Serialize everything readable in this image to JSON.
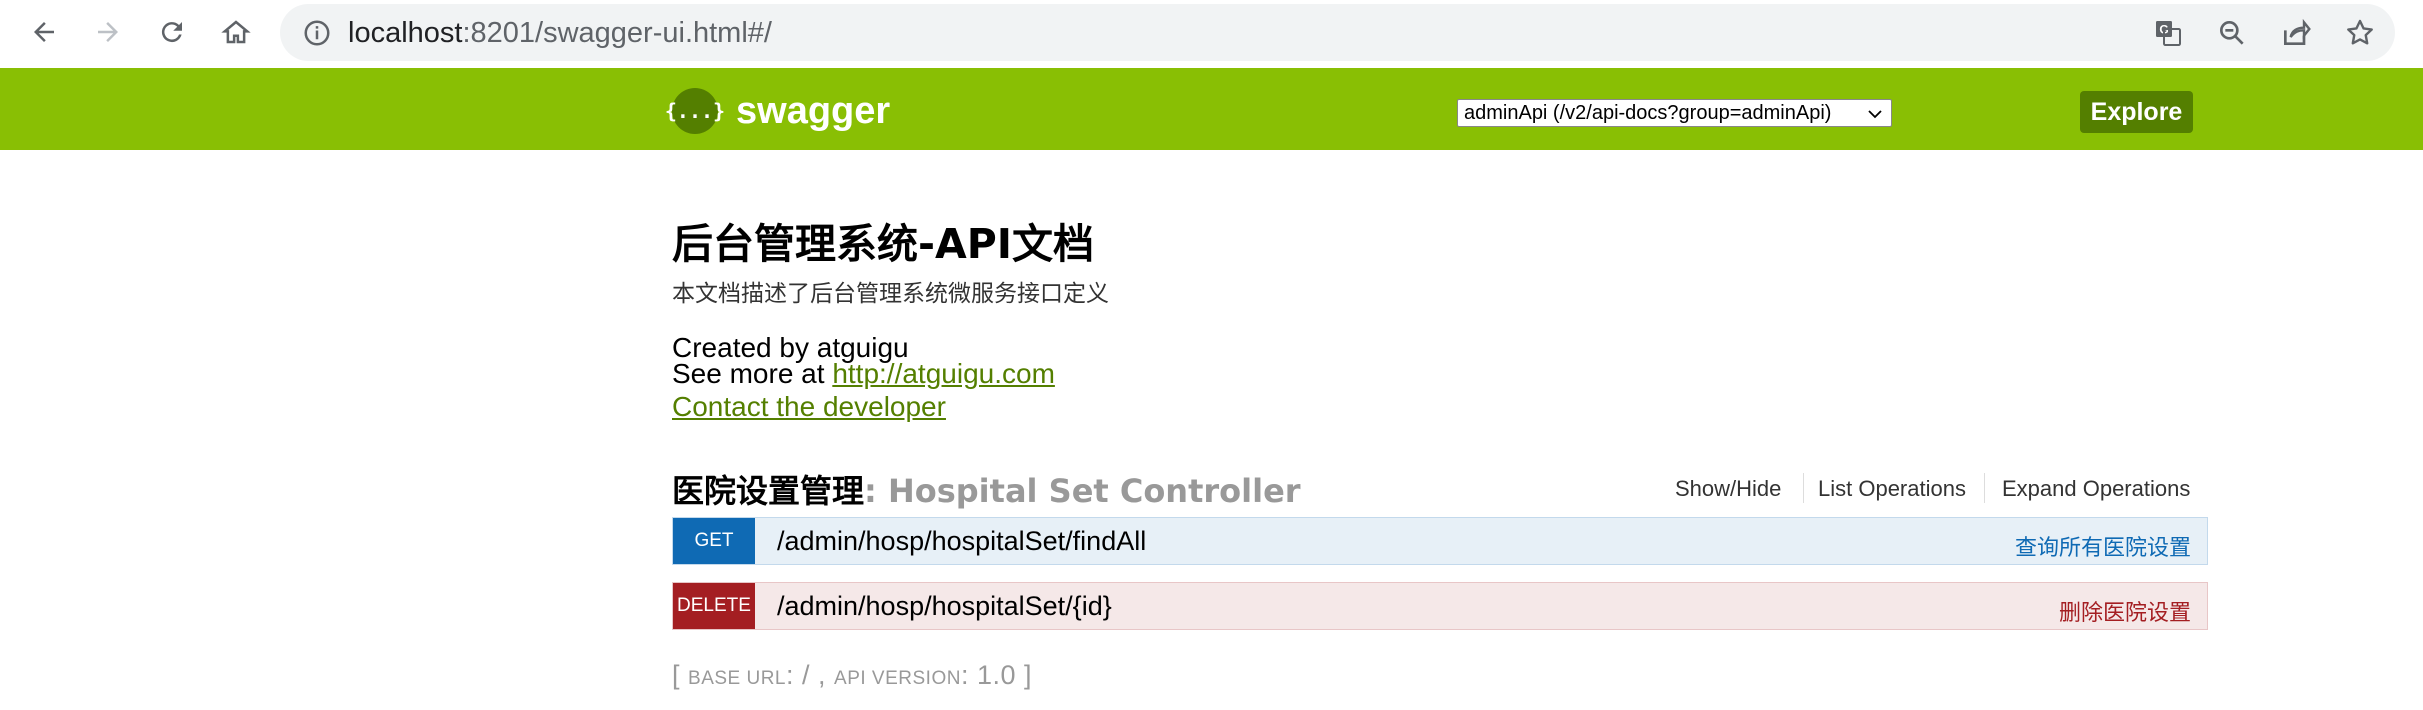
{
  "browser": {
    "url_host": "localhost",
    "url_rest": ":8201/swagger-ui.html#/",
    "icons": [
      "back-icon",
      "forward-icon",
      "reload-icon",
      "home-icon",
      "info-icon",
      "translate-icon",
      "zoom-icon",
      "share-icon",
      "bookmark-star-icon"
    ]
  },
  "swagger": {
    "logo_text": "swagger",
    "logo_glyph": "{...}",
    "api_select_value": "adminApi (/v2/api-docs?group=adminApi)",
    "explore_label": "Explore",
    "colors": {
      "header": "#89bf04",
      "dark_green": "#547f00"
    }
  },
  "info": {
    "title": "后台管理系统-API文档",
    "description": "本文档描述了后台管理系统微服务接口定义",
    "created_by": "Created by atguigu",
    "see_more_prefix": "See more at ",
    "see_more_link": "http://atguigu.com",
    "contact_link": "Contact the developer"
  },
  "resource": {
    "name_zh": "医院设置管理",
    "name_en": ": Hospital Set Controller",
    "options": [
      "Show/Hide",
      "List Operations",
      "Expand Operations"
    ],
    "operations": [
      {
        "method": "GET",
        "path": "/admin/hosp/hospitalSet/findAll",
        "summary": "查询所有医院设置",
        "color": "#0f6ab4"
      },
      {
        "method": "DELETE",
        "path": "/admin/hosp/hospitalSet/{id}",
        "summary": "删除医院设置",
        "color": "#a41e22"
      }
    ]
  },
  "footer": {
    "open": "[ ",
    "base_url_label": "BASE URL",
    "base_url_value": ": / , ",
    "api_version_label": "API VERSION",
    "api_version_value": ": 1.0 ]"
  }
}
